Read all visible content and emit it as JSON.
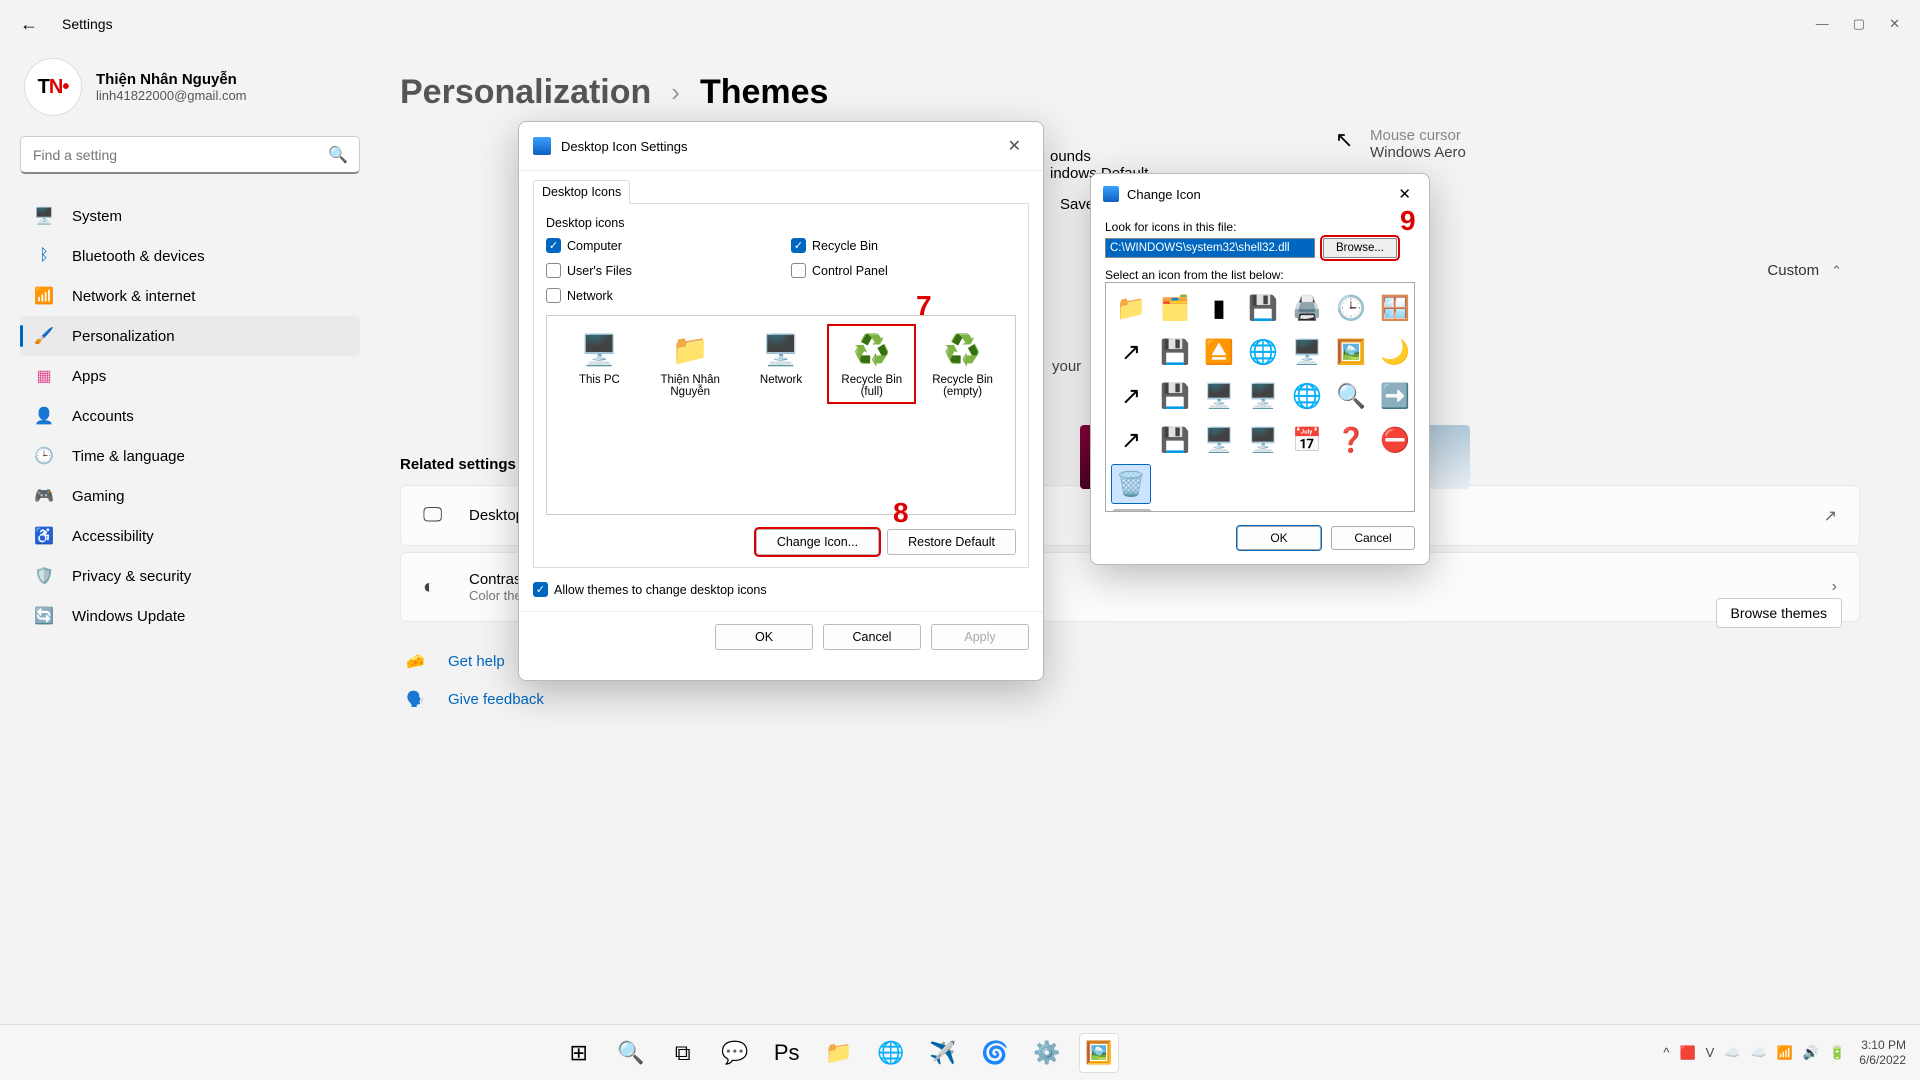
{
  "window": {
    "title": "Settings"
  },
  "user": {
    "name": "Thiện Nhân Nguyễn",
    "email": "linh41822000@gmail.com",
    "avatar": "TN"
  },
  "search": {
    "placeholder": "Find a setting"
  },
  "nav": [
    {
      "icon": "🖥️",
      "label": "System",
      "color": "#0067c0"
    },
    {
      "icon": "ᛒ",
      "label": "Bluetooth & devices",
      "color": "#0067c0"
    },
    {
      "icon": "📶",
      "label": "Network & internet",
      "color": "#0067c0"
    },
    {
      "icon": "🖌️",
      "label": "Personalization",
      "color": "#cc5500",
      "active": true
    },
    {
      "icon": "▦",
      "label": "Apps",
      "color": "#e05097"
    },
    {
      "icon": "👤",
      "label": "Accounts",
      "color": "#f28c28"
    },
    {
      "icon": "🕒",
      "label": "Time & language",
      "color": "#00b0b0"
    },
    {
      "icon": "🎮",
      "label": "Gaming",
      "color": "#888"
    },
    {
      "icon": "♿",
      "label": "Accessibility",
      "color": "#0067c0"
    },
    {
      "icon": "🛡️",
      "label": "Privacy & security",
      "color": "#777"
    },
    {
      "icon": "🔄",
      "label": "Windows Update",
      "color": "#0067c0"
    }
  ],
  "breadcrumb": {
    "parent": "Personalization",
    "child": "Themes"
  },
  "floaters": {
    "sounds_label": "ounds",
    "sounds_value": "indows Default",
    "mouse_label": "Mouse cursor",
    "mouse_value": "Windows Aero",
    "save": "Save",
    "your": "your",
    "custom": "Custom",
    "browse_themes": "Browse themes"
  },
  "related": {
    "title": "Related settings",
    "items": [
      {
        "title": "Desktop icon settings",
        "sub": ""
      },
      {
        "title": "Contrast themes",
        "sub": "Color themes for low vision, light sensitivity"
      }
    ]
  },
  "helplinks": {
    "help": "Get help",
    "feedback": "Give feedback"
  },
  "dlg1": {
    "title": "Desktop Icon Settings",
    "tab": "Desktop Icons",
    "group": "Desktop icons",
    "checks": [
      {
        "label": "Computer",
        "on": true
      },
      {
        "label": "Recycle Bin",
        "on": true
      },
      {
        "label": "User's Files",
        "on": false
      },
      {
        "label": "Control Panel",
        "on": false
      },
      {
        "label": "Network",
        "on": false
      }
    ],
    "icons": [
      {
        "glyph": "🖥️",
        "label": "This PC"
      },
      {
        "glyph": "📁",
        "label": "Thiện Nhân Nguyễn"
      },
      {
        "glyph": "🖥️",
        "label": "Network"
      },
      {
        "glyph": "♻️",
        "label": "Recycle Bin (full)",
        "selected": true
      },
      {
        "glyph": "♻️",
        "label": "Recycle Bin (empty)"
      }
    ],
    "change_icon": "Change Icon...",
    "restore": "Restore Default",
    "allow": "Allow themes to change desktop icons",
    "ok": "OK",
    "cancel": "Cancel",
    "apply": "Apply"
  },
  "dlg2": {
    "title": "Change Icon",
    "look_label": "Look for icons in this file:",
    "path": "C:\\WINDOWS\\system32\\shell32.dll",
    "browse": "Browse...",
    "select_label": "Select an icon from the list below:",
    "icons": [
      "📁",
      "🗂️",
      "▮",
      "💾",
      "🖨️",
      "🕒",
      "🪟",
      "↗",
      "💾",
      "⏏️",
      "🌐",
      "🖥️",
      "🖼️",
      "🌙",
      "↗",
      "💾",
      "🖥️",
      "🖥️",
      "🌐",
      "🔍",
      "➡️",
      "↗",
      "💾",
      "🖥️",
      "🖥️",
      "📅",
      "❓",
      "⛔",
      "🗑️"
    ],
    "selected_index": 28,
    "ok": "OK",
    "cancel": "Cancel"
  },
  "annotations": {
    "a7": "7",
    "a8": "8",
    "a9": "9"
  },
  "taskbar": {
    "items": [
      {
        "glyph": "⊞",
        "name": "start"
      },
      {
        "glyph": "🔍",
        "name": "search"
      },
      {
        "glyph": "⧉",
        "name": "taskview"
      },
      {
        "glyph": "💬",
        "name": "chat"
      },
      {
        "glyph": "Ps",
        "name": "photoshop"
      },
      {
        "glyph": "📁",
        "name": "explorer"
      },
      {
        "glyph": "🌐",
        "name": "chrome"
      },
      {
        "glyph": "✈️",
        "name": "telegram"
      },
      {
        "glyph": "🌀",
        "name": "edge"
      },
      {
        "glyph": "⚙️",
        "name": "settings"
      },
      {
        "glyph": "🖼️",
        "name": "app",
        "active": true
      }
    ],
    "tray": [
      "^",
      "🟥",
      "V",
      "☁️",
      "☁️",
      "📶",
      "🔊",
      "🔋"
    ],
    "time": "3:10 PM",
    "date": "6/6/2022"
  }
}
